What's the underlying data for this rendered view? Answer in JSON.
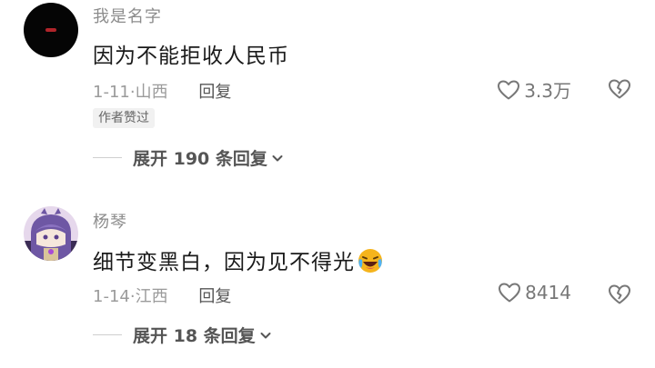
{
  "comments": [
    {
      "username": "我是名字",
      "text": "因为不能拒收人民币",
      "date": "1-11",
      "separator": "·",
      "location": "山西",
      "reply_label": "回复",
      "likes": "3.3万",
      "badge": "作者赞过",
      "expand_label": "展开 190 条回复"
    },
    {
      "username": "杨琴",
      "text": "细节变黑白，因为见不得光",
      "emoji": "laughing-crying-emoji",
      "date": "1-14",
      "separator": "·",
      "location": "江西",
      "reply_label": "回复",
      "likes": "8414",
      "expand_label": "展开 18 条回复"
    }
  ],
  "colors": {
    "background": "#ffffff",
    "username": "#8c8c8c",
    "meta": "#9b9b9b",
    "text": "#1a1a1a",
    "avatar_1": "#050505",
    "emoji": "#f5b41c"
  }
}
